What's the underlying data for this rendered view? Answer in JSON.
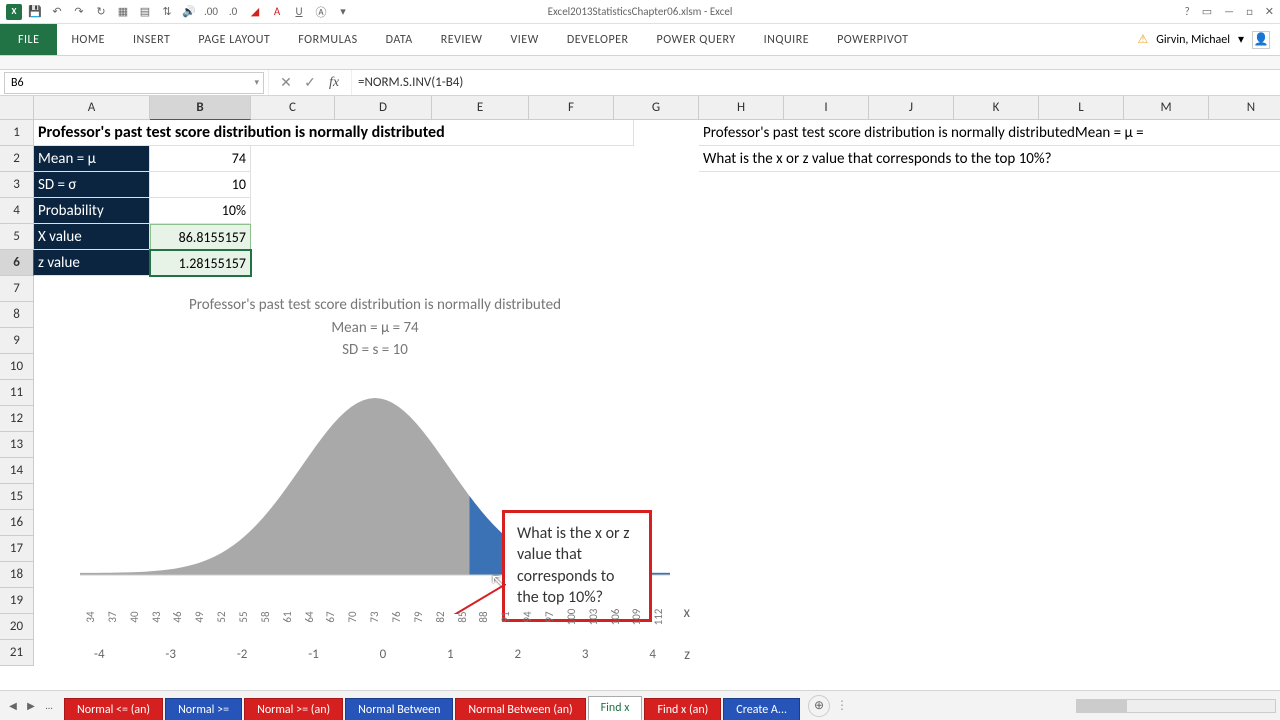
{
  "app": {
    "title": "Excel2013StatisticsChapter06.xlsm - Excel",
    "user": "Girvin, Michael"
  },
  "ribbon": {
    "file": "FILE",
    "tabs": [
      "HOME",
      "INSERT",
      "PAGE LAYOUT",
      "FORMULAS",
      "DATA",
      "REVIEW",
      "VIEW",
      "DEVELOPER",
      "POWER QUERY",
      "INQUIRE",
      "POWERPIVOT"
    ]
  },
  "name_box": "B6",
  "formula": "=NORM.S.INV(1-B4)",
  "columns": [
    {
      "label": "A",
      "w": 116
    },
    {
      "label": "B",
      "w": 101
    },
    {
      "label": "C",
      "w": 84
    },
    {
      "label": "D",
      "w": 97
    },
    {
      "label": "E",
      "w": 97
    },
    {
      "label": "F",
      "w": 85
    },
    {
      "label": "G",
      "w": 85
    },
    {
      "label": "H",
      "w": 85
    },
    {
      "label": "I",
      "w": 85
    },
    {
      "label": "J",
      "w": 85
    },
    {
      "label": "K",
      "w": 85
    },
    {
      "label": "L",
      "w": 85
    },
    {
      "label": "M",
      "w": 85
    },
    {
      "label": "N",
      "w": 85
    }
  ],
  "rows": 21,
  "selected_col_idx": 1,
  "selected_row": 6,
  "heading": "Professor's past test score distribution is normally distributed",
  "labels": {
    "mean": "Mean = μ",
    "sd": "SD = σ",
    "prob": "Probability",
    "x": "X value",
    "z": "z value"
  },
  "values": {
    "mean": "74",
    "sd": "10",
    "prob": "10%",
    "x": "86.8155157",
    "z": "1.28155157"
  },
  "side_q1": "Professor's past test score distribution is normally distributedMean = μ =",
  "side_q2": "What is the x or z value that corresponds to the top 10%?",
  "chart": {
    "title1": "Professor's past test score distribution is normally distributed",
    "title2": "Mean = μ = 74",
    "title3": "SD = s = 10",
    "x_ticks": [
      "34",
      "37",
      "40",
      "43",
      "46",
      "49",
      "52",
      "55",
      "58",
      "61",
      "64",
      "67",
      "70",
      "73",
      "76",
      "79",
      "82",
      "85",
      "88",
      "91",
      "94",
      "97",
      "100",
      "103",
      "106",
      "109",
      "112"
    ],
    "z_ticks": [
      "-4",
      "-3",
      "-2",
      "-1",
      "0",
      "1",
      "2",
      "3",
      "4"
    ],
    "x_label": "x",
    "z_label": "z",
    "callout": "What is the x or z value that corresponds to the top 10%?"
  },
  "chart_data": {
    "type": "area",
    "title": "Professor's past test score distribution is normally distributed",
    "subtitle": "Mean = μ = 74, SD = s = 10",
    "distribution": "normal",
    "mean": 74,
    "sd": 10,
    "x_range": [
      34,
      114
    ],
    "x_ticks": [
      34,
      37,
      40,
      43,
      46,
      49,
      52,
      55,
      58,
      61,
      64,
      67,
      70,
      73,
      76,
      79,
      82,
      85,
      88,
      91,
      94,
      97,
      100,
      103,
      106,
      109,
      112
    ],
    "z_ticks": [
      -4,
      -3,
      -2,
      -1,
      0,
      1,
      2,
      3,
      4
    ],
    "highlight_region": {
      "from_x": 86.8155157,
      "to_x": 114,
      "area": 0.1,
      "color": "#3a72b5"
    },
    "base_color": "#a9a9a9",
    "annotation": "What is the x or z value that corresponds to the top 10%?"
  },
  "sheets": {
    "ellipsis": "...",
    "tabs": [
      {
        "label": "Normal <= (an)",
        "color": "red"
      },
      {
        "label": "Normal >=",
        "color": "blue"
      },
      {
        "label": "Normal >= (an)",
        "color": "red"
      },
      {
        "label": "Normal Between",
        "color": "blue"
      },
      {
        "label": "Normal Between (an)",
        "color": "red"
      },
      {
        "label": "Find x",
        "color": "active"
      },
      {
        "label": "Find x (an)",
        "color": "red"
      },
      {
        "label": "Create A...",
        "color": "blue"
      }
    ]
  }
}
